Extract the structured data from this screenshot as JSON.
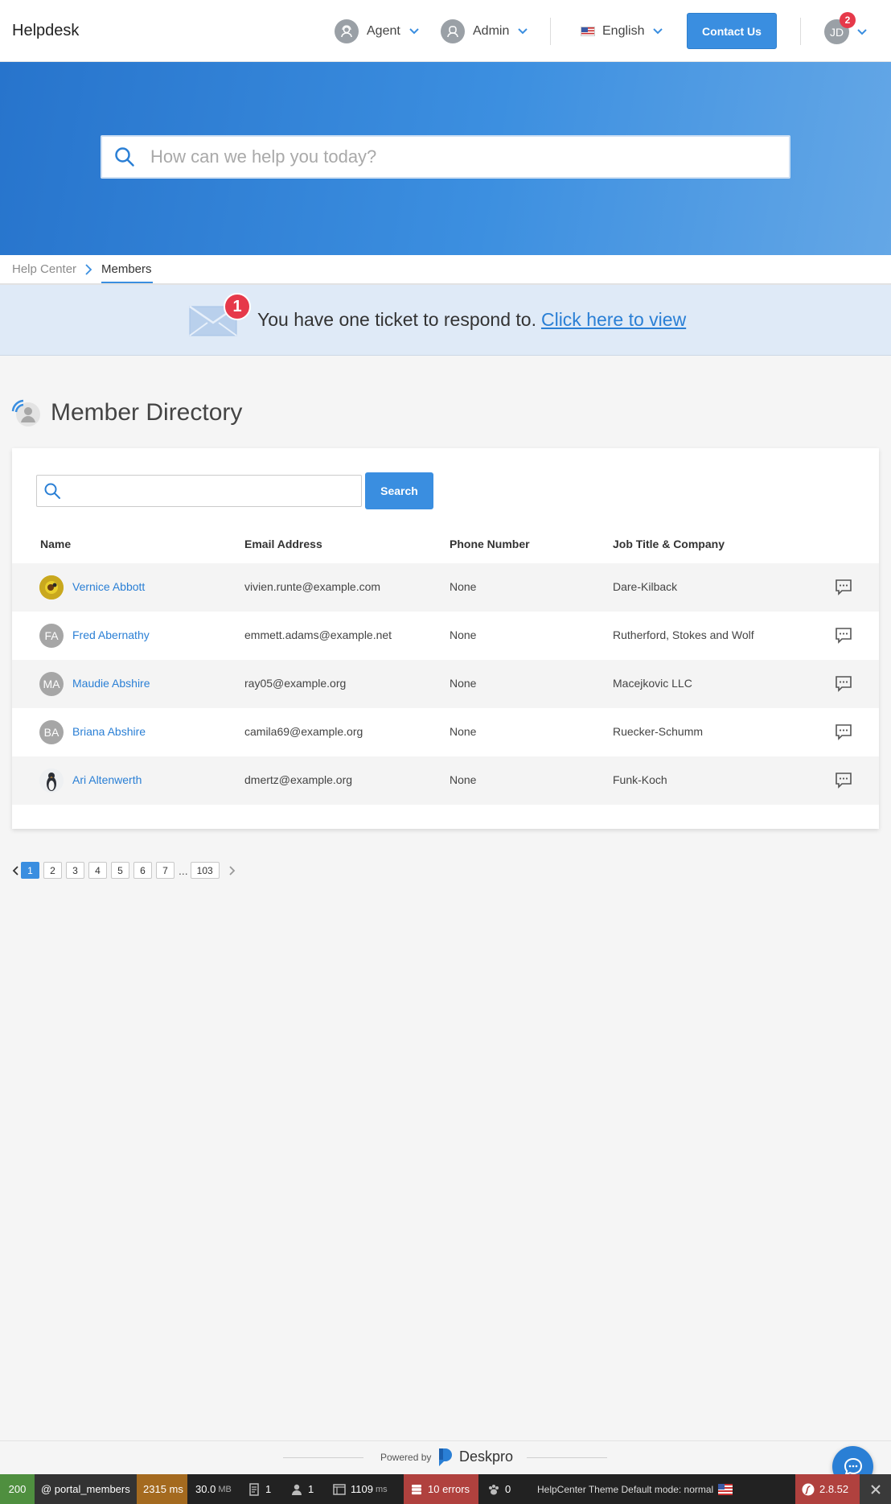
{
  "header": {
    "brand": "Helpdesk",
    "agent_label": "Agent",
    "admin_label": "Admin",
    "language": "English",
    "contact_label": "Contact Us",
    "user_initials": "JD",
    "user_badge": "2"
  },
  "hero": {
    "search_placeholder": "How can we help you today?"
  },
  "breadcrumb": {
    "home": "Help Center",
    "current": "Members"
  },
  "notice": {
    "badge": "1",
    "text": "You have one ticket to respond to.",
    "link": "Click here to view"
  },
  "directory": {
    "title": "Member Directory",
    "search_button": "Search",
    "columns": [
      "Name",
      "Email Address",
      "Phone Number",
      "Job Title & Company"
    ],
    "members": [
      {
        "name": "Vernice Abbott",
        "email": "vivien.runte@example.com",
        "phone": "None",
        "company": "Dare-Kilback",
        "initials": "",
        "avatar": "photo-sunflower"
      },
      {
        "name": "Fred Abernathy",
        "email": "emmett.adams@example.net",
        "phone": "None",
        "company": "Rutherford, Stokes and Wolf",
        "initials": "FA",
        "avatar": "initials"
      },
      {
        "name": "Maudie Abshire",
        "email": "ray05@example.org",
        "phone": "None",
        "company": "Macejkovic LLC",
        "initials": "MA",
        "avatar": "initials"
      },
      {
        "name": "Briana Abshire",
        "email": "camila69@example.org",
        "phone": "None",
        "company": "Ruecker-Schumm",
        "initials": "BA",
        "avatar": "initials"
      },
      {
        "name": "Ari Altenwerth",
        "email": "dmertz@example.org",
        "phone": "None",
        "company": "Funk-Koch",
        "initials": "",
        "avatar": "photo-penguin"
      }
    ]
  },
  "pagination": {
    "pages": [
      "1",
      "2",
      "3",
      "4",
      "5",
      "6",
      "7"
    ],
    "ellipsis": "...",
    "last": "103",
    "current": "1"
  },
  "footer": {
    "powered_by": "Powered by",
    "brand": "Deskpro"
  },
  "debug_toolbar": {
    "status": "200",
    "route": "@ portal_members",
    "time": "2315 ms",
    "memory": "30.0",
    "memory_unit": "MB",
    "logs": "1",
    "user": "1",
    "render_time": "1109",
    "render_unit": "ms",
    "errors": "10 errors",
    "events": "0",
    "theme": "HelpCenter Theme Default mode: normal",
    "version": "2.8.52"
  },
  "colors": {
    "accent": "#3a8ee0",
    "link": "#2a7fd5",
    "badge": "#e6394a",
    "notice_bg": "#dfeaf7"
  },
  "icons": [
    "user-icon",
    "admin-icon",
    "chevron-down-icon",
    "us-flag-icon",
    "search-icon",
    "chevron-right-icon",
    "envelope-icon",
    "members-icon",
    "chat-bubble-icon",
    "chevron-left-icon",
    "deskpro-logo-icon",
    "close-icon"
  ]
}
